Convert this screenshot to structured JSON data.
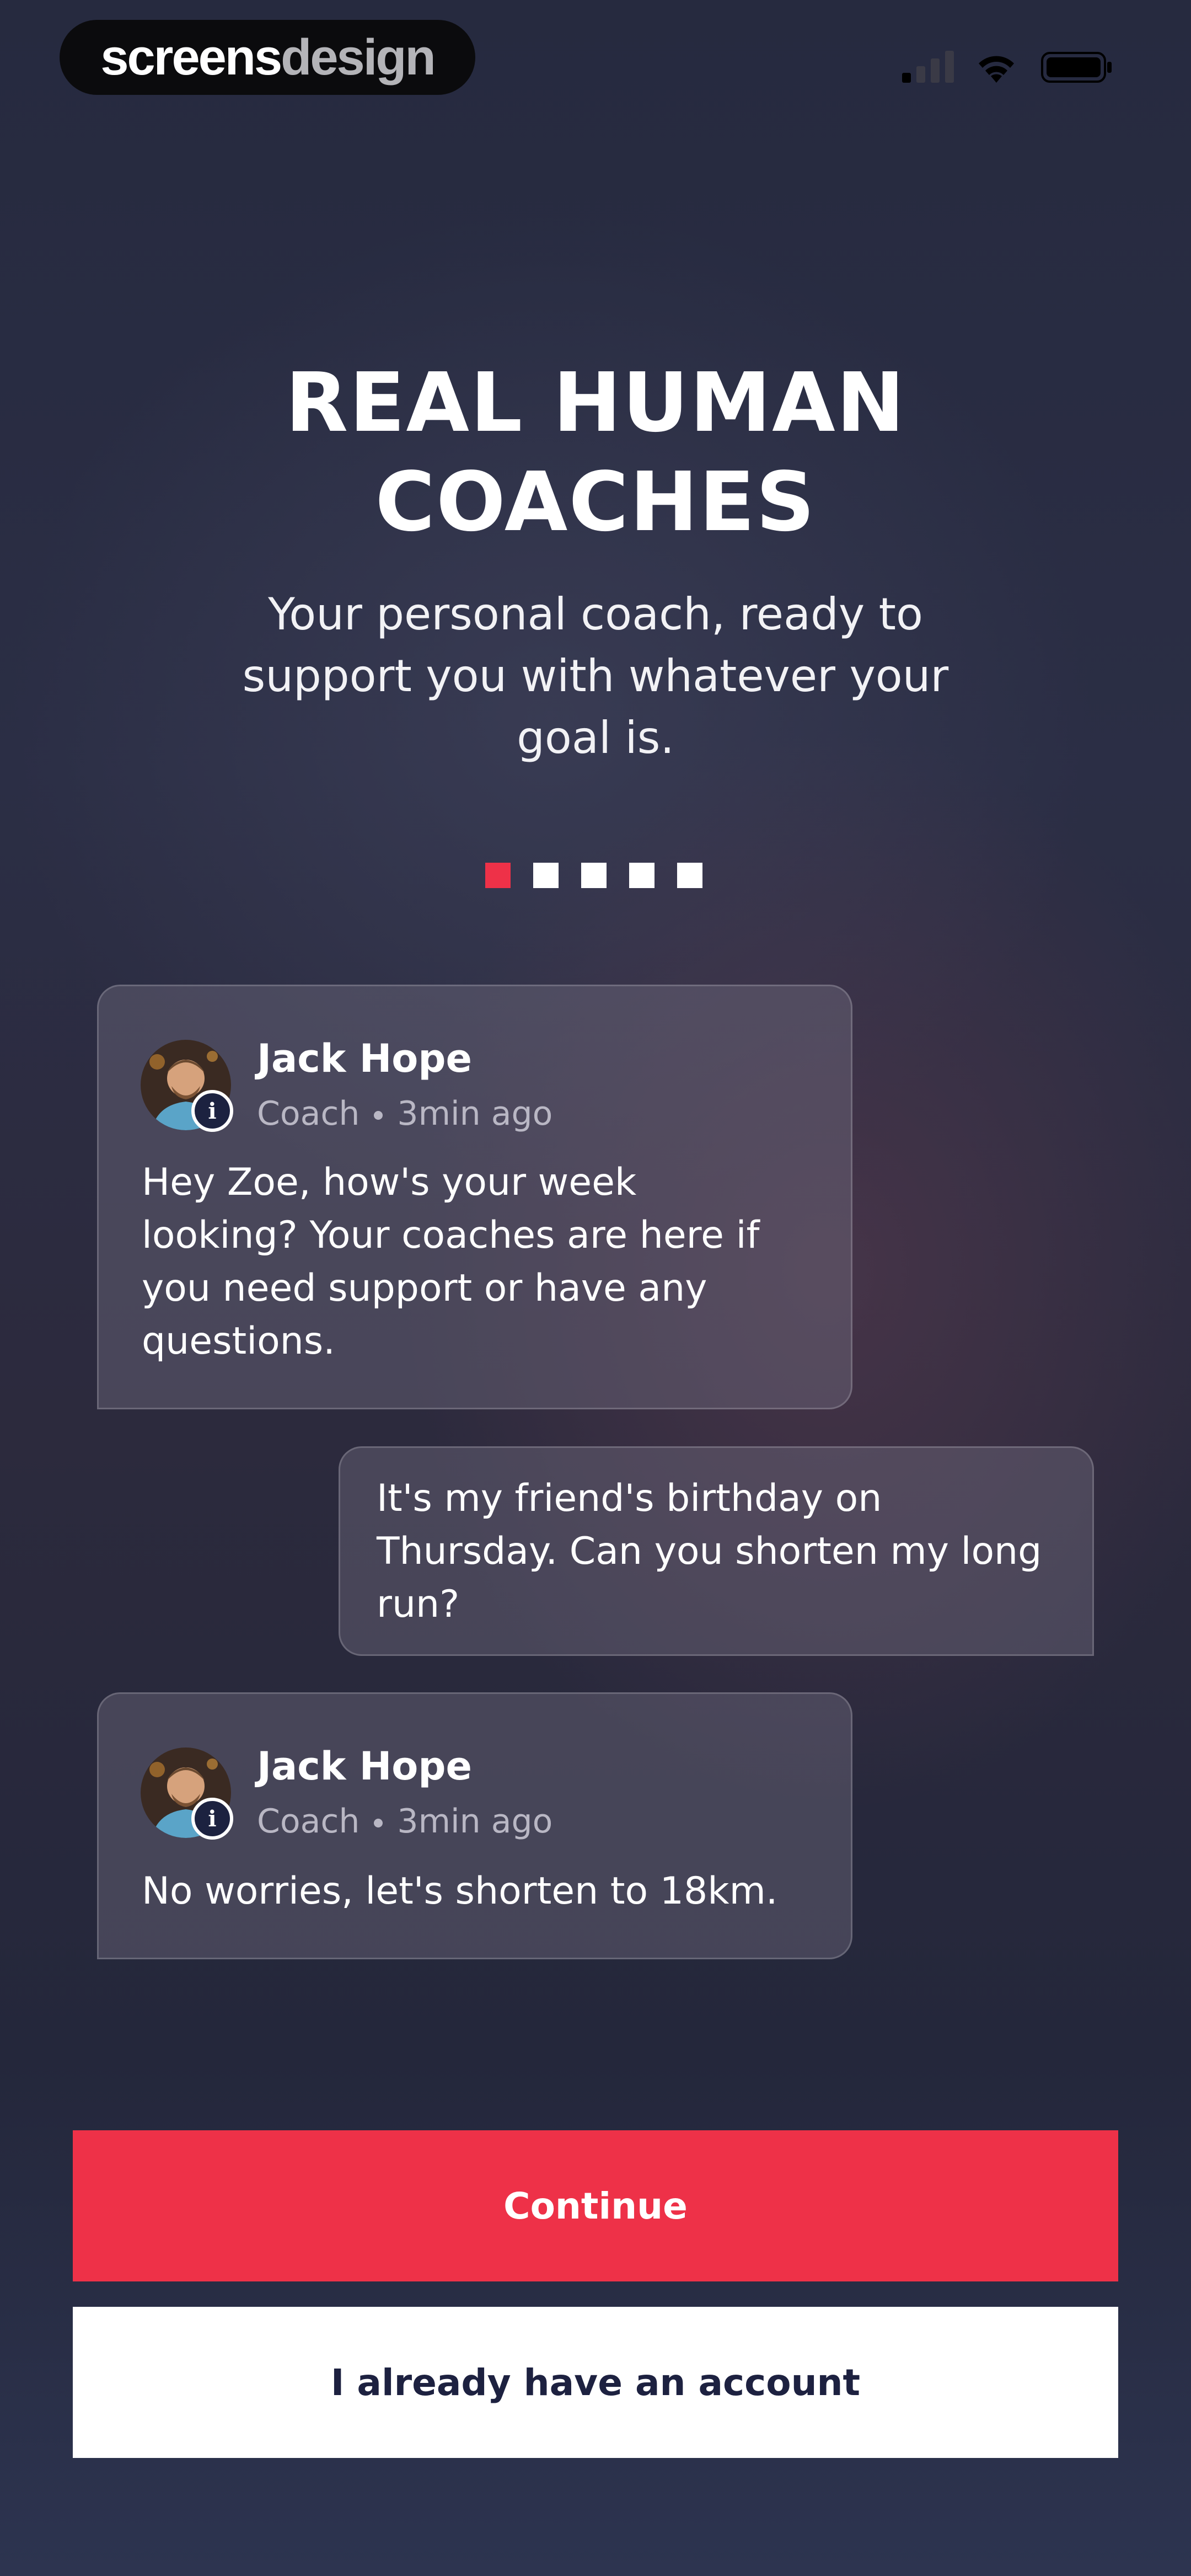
{
  "status_bar": {
    "brand_part1": "screens",
    "brand_part2": "design"
  },
  "header": {
    "title_line1": "REAL HUMAN",
    "title_line2": "COACHES",
    "subtitle": "Your personal coach, ready to support you with whatever your goal is."
  },
  "pagination": {
    "total": 5,
    "active_index": 0,
    "active_color": "#ee3148",
    "inactive_color": "#ffffff"
  },
  "chat": {
    "messages": [
      {
        "sender": "Jack Hope",
        "role": "Coach",
        "time": "3min ago",
        "text": "Hey Zoe, how's your week looking? Your coaches are here if you need support or have any questions."
      },
      {
        "sender": "user",
        "text": "It's my friend's birthday on Thursday. Can you shorten my long run?"
      },
      {
        "sender": "Jack Hope",
        "role": "Coach",
        "time": "3min ago",
        "text": "No worries, let's shorten to 18km."
      }
    ]
  },
  "buttons": {
    "continue_label": "Continue",
    "account_label": "I already have an account"
  },
  "colors": {
    "accent": "#ee3148",
    "background": "#272a3f"
  }
}
